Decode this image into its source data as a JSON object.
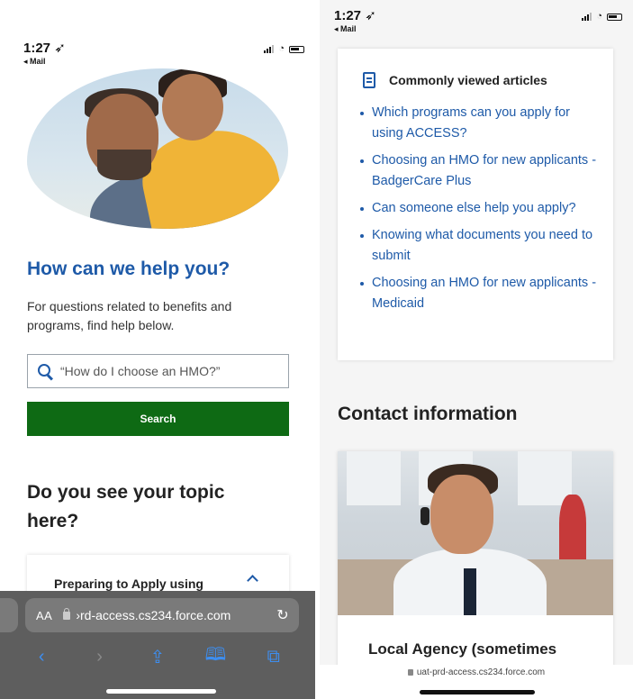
{
  "left": {
    "status": {
      "time": "1:27 ➶",
      "back_app": "◂ Mail"
    },
    "help": {
      "title": "How can we help you?",
      "subtitle": "For questions related to benefits and programs, find help below."
    },
    "search": {
      "placeholder": "“How do I choose an HMO?”",
      "button_label": "Search"
    },
    "topics": {
      "title": "Do you see your topic here?",
      "first_item": "Preparing to Apply using"
    },
    "browser": {
      "aa": "AA",
      "url": "›rd-access.cs234.force.com",
      "reload": "↻"
    },
    "toolbar": {
      "back": "‹",
      "forward": "›",
      "share": "⇪",
      "bookmarks": "🕮",
      "tabs": "⧉"
    }
  },
  "right": {
    "status": {
      "time": "1:27 ➶",
      "back_app": "◂ Mail"
    },
    "articles": {
      "title": "Commonly viewed articles",
      "items": [
        "Which programs can you apply for using ACCESS?",
        "Choosing an HMO for new applicants - BadgerCare Plus",
        "Can someone else help you apply?",
        "Knowing what documents you need to submit",
        "Choosing an HMO for new applicants - Medicaid"
      ]
    },
    "contact": {
      "title": "Contact information",
      "card_title": "Local Agency (sometimes"
    },
    "browser": {
      "url": "uat-prd-access.cs234.force.com"
    }
  },
  "colors": {
    "link_blue": "#1e5aa8",
    "search_green": "#0e6a14",
    "safari_gray": "#5e5e5e",
    "ios_blue": "#3d8ef0"
  }
}
